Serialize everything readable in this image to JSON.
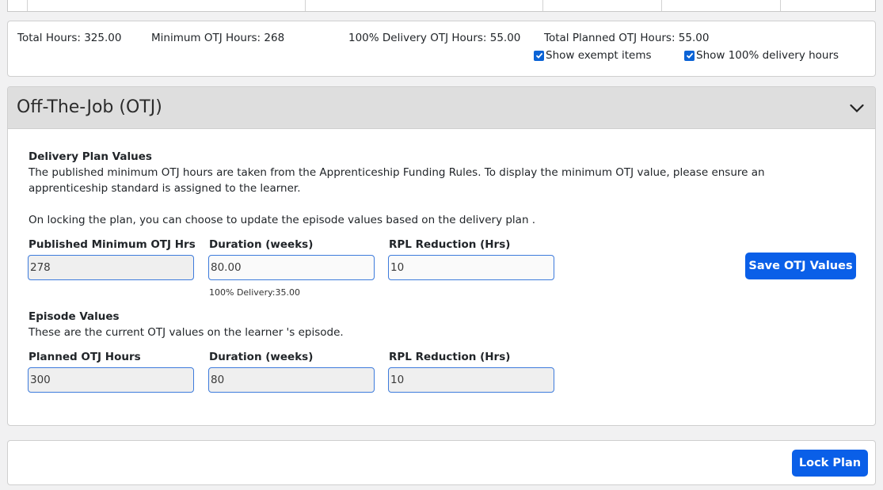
{
  "summary": {
    "total_hours": "Total Hours: 325.00",
    "minimum_otj_hours": "Minimum OTJ Hours: 268",
    "delivery_otj_hours": "100% Delivery OTJ Hours: 55.00",
    "total_planned_otj_hours": "Total Planned OTJ Hours: 55.00",
    "show_exempt_label": "Show exempt items",
    "show_exempt_checked": true,
    "show_delivery_label": "Show 100% delivery hours",
    "show_delivery_checked": true
  },
  "otj": {
    "title": "Off-The-Job (OTJ)",
    "delivery_plan": {
      "heading": "Delivery Plan Values",
      "description": "The published minimum OTJ hours are taken from the Apprenticeship Funding Rules. To display the minimum OTJ value, please ensure an apprenticeship standard is assigned to the learner.",
      "locking_note": "On locking the plan, you can choose to update the episode values based on the delivery plan .",
      "fields": {
        "published_min_label": "Published Minimum OTJ Hrs",
        "published_min_value": "278",
        "duration_label": "Duration (weeks)",
        "duration_value": "80.00",
        "duration_hint": "100% Delivery:35.00",
        "rpl_label": "RPL Reduction (Hrs)",
        "rpl_value": "10"
      },
      "save_button": "Save OTJ Values"
    },
    "episode": {
      "heading": "Episode Values",
      "description": "These are the current OTJ values on the learner 's episode.",
      "fields": {
        "planned_label": "Planned OTJ Hours",
        "planned_value": "300",
        "duration_label": "Duration (weeks)",
        "duration_value": "80",
        "rpl_label": "RPL Reduction (Hrs)",
        "rpl_value": "10"
      }
    }
  },
  "footer": {
    "lock_button": "Lock Plan"
  },
  "colors": {
    "primary": "#0a5fe8",
    "header_bg": "#dedede",
    "page_bg": "#f1f1f2"
  }
}
